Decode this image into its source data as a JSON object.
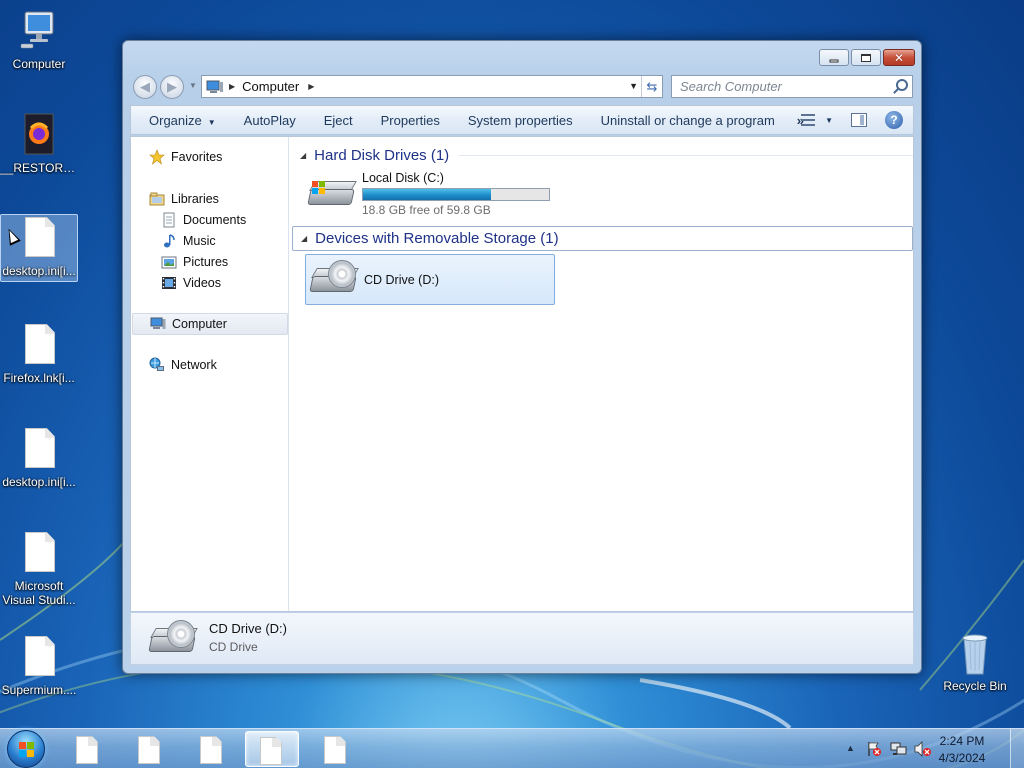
{
  "desktop": {
    "icons": [
      {
        "label": "Computer",
        "icon": "computer-icon"
      },
      {
        "label": "__RESTORE...",
        "icon": "firefox-icon"
      },
      {
        "label": "desktop.ini[i...",
        "icon": "file-icon"
      },
      {
        "label": "Firefox.lnk[i...",
        "icon": "file-icon"
      },
      {
        "label": "desktop.ini[i...",
        "icon": "file-icon"
      },
      {
        "label": "Microsoft Visual Studi...",
        "line1": "Microsoft",
        "line2": "Visual Studi...",
        "icon": "file-icon"
      },
      {
        "label": "Supermium....",
        "icon": "file-icon"
      },
      {
        "label": "Recycle Bin",
        "icon": "recycle-bin-icon"
      }
    ]
  },
  "window": {
    "address": {
      "location": "Computer"
    },
    "search": {
      "placeholder": "Search Computer"
    },
    "toolbar": {
      "organize": "Organize",
      "autoplay": "AutoPlay",
      "eject": "Eject",
      "properties": "Properties",
      "system_properties": "System properties",
      "uninstall": "Uninstall or change a program",
      "more": "»"
    },
    "nav": {
      "favorites": "Favorites",
      "libraries": "Libraries",
      "documents": "Documents",
      "music": "Music",
      "pictures": "Pictures",
      "videos": "Videos",
      "computer": "Computer",
      "network": "Network"
    },
    "groups": {
      "hard_disk": "Hard Disk Drives (1)",
      "removable": "Devices with Removable Storage (1)"
    },
    "drives": {
      "local": {
        "name": "Local Disk (C:)",
        "free_text": "18.8 GB free of 59.8 GB",
        "used_fraction": 0.686
      },
      "cd": {
        "name": "CD Drive (D:)"
      }
    },
    "details": {
      "name": "CD Drive (D:)",
      "type": "CD Drive"
    }
  },
  "taskbar": {
    "clock_time": "2:24 PM",
    "clock_date": "4/3/2024",
    "tray_arrow": "▲"
  },
  "colors": {
    "accent": "#1e3287",
    "bar_fill": "#1e8ecb",
    "close_button": "#c7503a"
  }
}
